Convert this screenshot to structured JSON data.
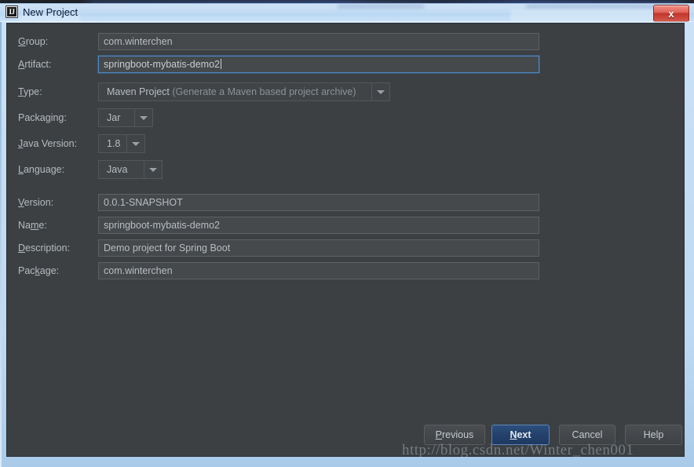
{
  "window": {
    "title": "New Project",
    "app_icon": "intellij-idea-icon",
    "icon_glyph": "IJ",
    "close_label": "x",
    "frame_color": "#c3dcf3",
    "dialog_bg": "#3c4043"
  },
  "form": {
    "rows": [
      {
        "key": "group",
        "label_pre": "",
        "mnemonic": "G",
        "label_post": "roup:",
        "value": "com.winterchen",
        "type": "text"
      },
      {
        "key": "artifact",
        "label_pre": "",
        "mnemonic": "A",
        "label_post": "rtifact:",
        "value": "springboot-mybatis-demo2",
        "type": "text",
        "focused": true
      },
      {
        "key": "type",
        "label_pre": "",
        "mnemonic": "T",
        "label_post": "ype:",
        "value": "Maven Project",
        "hint": "(Generate a Maven based project archive)",
        "type": "combo"
      },
      {
        "key": "packaging",
        "label_pre": "Packa",
        "mnemonic": "g",
        "label_post": "ing:",
        "value": "Jar",
        "type": "combo"
      },
      {
        "key": "java_version",
        "label_pre": "",
        "mnemonic": "J",
        "label_post": "ava Version:",
        "value": "1.8",
        "type": "combo"
      },
      {
        "key": "language",
        "label_pre": "",
        "mnemonic": "L",
        "label_post": "anguage:",
        "value": "Java",
        "type": "combo"
      },
      {
        "key": "version",
        "label_pre": "",
        "mnemonic": "V",
        "label_post": "ersion:",
        "value": "0.0.1-SNAPSHOT",
        "type": "text"
      },
      {
        "key": "name",
        "label_pre": "Na",
        "mnemonic": "m",
        "label_post": "e:",
        "value": "springboot-mybatis-demo2",
        "type": "text"
      },
      {
        "key": "description",
        "label_pre": "",
        "mnemonic": "D",
        "label_post": "escription:",
        "value": "Demo project for Spring Boot",
        "type": "text"
      },
      {
        "key": "package",
        "label_pre": "Pac",
        "mnemonic": "k",
        "label_post": "age:",
        "value": "com.winterchen",
        "type": "text"
      }
    ]
  },
  "buttons": {
    "previous": {
      "pre": "",
      "mnemonic": "P",
      "post": "revious"
    },
    "next": {
      "pre": "",
      "mnemonic": "N",
      "post": "ext",
      "default": true
    },
    "cancel": {
      "pre": "Cancel",
      "mnemonic": "",
      "post": ""
    },
    "help": {
      "pre": "Help",
      "mnemonic": "",
      "post": ""
    }
  },
  "watermark": {
    "text": "http://blog.csdn.net/Winter_chen001"
  }
}
